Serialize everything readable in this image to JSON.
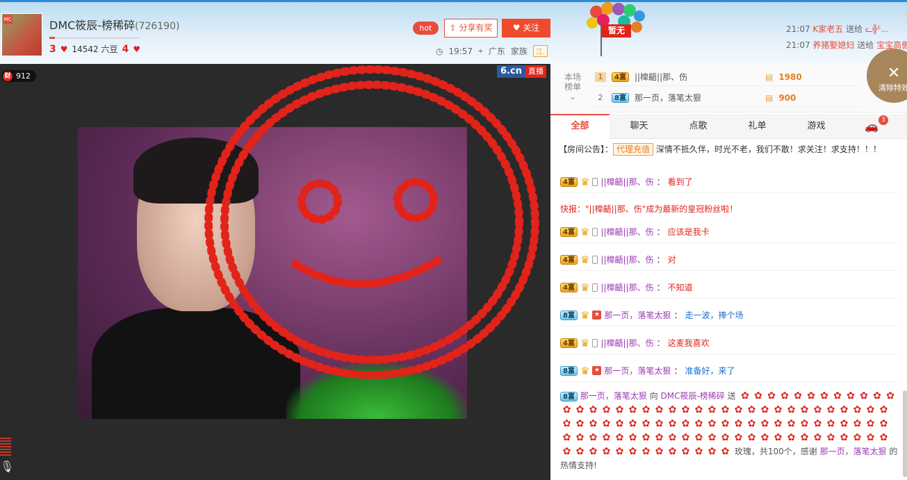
{
  "header": {
    "avatar_tag": "MC",
    "title": "DMC筱辰-榜稀碎",
    "room_id": "(726190)",
    "level_left": "3",
    "beans": "14542 六豆",
    "level_right": "4",
    "hot_label": "hot",
    "share_label": "分享有奖",
    "follow_label": "关注",
    "time": "19:57",
    "location": "广东",
    "family_label": "家族",
    "family_tag": "江.",
    "zanwu_label": "暂无",
    "feed": [
      {
        "time": "21:07",
        "name": "K家老五",
        "action": "送给",
        "target": "ᓚ╬ᑦ..."
      },
      {
        "time": "21:07",
        "name": "养猪娶媳妇",
        "action": "送给",
        "target": "宝宝高傲"
      }
    ]
  },
  "video": {
    "wealth_label": "财",
    "wealth_count": "912",
    "logo_main": "6.cn",
    "logo_live": "直播"
  },
  "rank": {
    "label_line1": "本场",
    "label_line2": "榜单",
    "rows": [
      {
        "rank": "1",
        "badge": "4富",
        "name": "||橰齬||那、伤",
        "value": "1980"
      },
      {
        "rank": "2",
        "badge": "8富",
        "name": "那一页，落笔太狠",
        "value": "900"
      }
    ],
    "clear_label": "清除特效"
  },
  "tabs": [
    "全部",
    "聊天",
    "点歌",
    "礼单",
    "游戏"
  ],
  "car_count": "3",
  "notice": {
    "prefix": "【房间公告】：",
    "tag": "代理充值",
    "text": "深情不抵久伴，时光不老，我们不散！求关注！求支持！！！"
  },
  "chat": [
    {
      "badge": "4富",
      "icon": "phone",
      "name": "||橰齬||那、伤",
      "text": "看到了"
    },
    {
      "flash": "快报：\"||橰齬||那、伤\"成为最新的皇冠粉丝啦！"
    },
    {
      "badge": "4富",
      "icon": "phone",
      "name": "||橰齬||那、伤",
      "text": "应该是我卡"
    },
    {
      "badge": "4富",
      "icon": "phone",
      "name": "||橰齬||那、伤",
      "text": "对"
    },
    {
      "badge": "4富",
      "icon": "phone",
      "name": "||橰齬||那、伤",
      "text": "不知道"
    },
    {
      "badge": "8富",
      "icon": "star",
      "name": "那一页，落笔太狠",
      "text": "走一波，捧个场"
    },
    {
      "badge": "4富",
      "icon": "phone",
      "name": "||橰齬||那、伤",
      "text": "这麦我喜欢"
    },
    {
      "badge": "8富",
      "icon": "star",
      "name": "那一页，落笔太狠",
      "text": "准备好，来了"
    }
  ],
  "gift": {
    "badge": "8富",
    "sender": "那一页，落笔太狠",
    "to": "向",
    "receiver": "DMC筱辰-榜稀碎",
    "send": "送",
    "summary_pre": "玫瑰，共100个，感谢",
    "thanks_name": "那一页，落笔太狠",
    "summary_post": "的热情支持!"
  },
  "colors": {
    "accent": "#e74c3c",
    "follow": "#ef4a2c",
    "rose": "#e2231a"
  }
}
